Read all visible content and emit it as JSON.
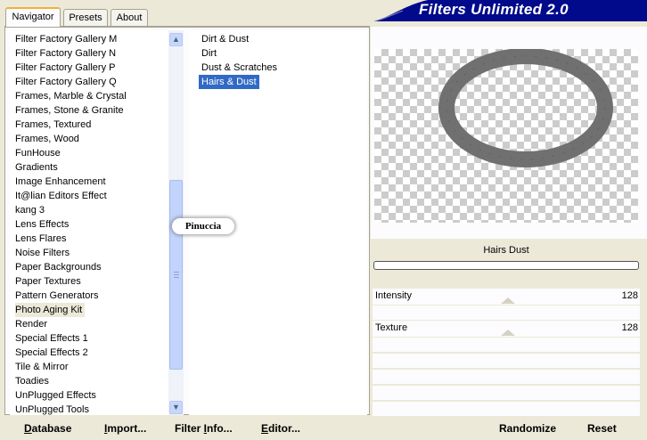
{
  "window": {
    "banner_title": "Filters Unlimited 2.0"
  },
  "tabs": [
    {
      "label": "Navigator",
      "active": true
    },
    {
      "label": "Presets",
      "active": false
    },
    {
      "label": "About",
      "active": false
    }
  ],
  "categories": {
    "items": [
      "Filter Factory Gallery M",
      "Filter Factory Gallery N",
      "Filter Factory Gallery P",
      "Filter Factory Gallery Q",
      "Frames, Marble & Crystal",
      "Frames, Stone & Granite",
      "Frames, Textured",
      "Frames, Wood",
      "FunHouse",
      "Gradients",
      "Image Enhancement",
      "It@lian Editors Effect",
      "kang 3",
      "Lens Effects",
      "Lens Flares",
      "Noise Filters",
      "Paper Backgrounds",
      "Paper Textures",
      "Pattern Generators",
      "Photo Aging Kit",
      "Render",
      "Special Effects 1",
      "Special Effects 2",
      "Tile & Mirror",
      "Toadies",
      "UnPlugged Effects",
      "UnPlugged Tools"
    ],
    "selected": "Photo Aging Kit"
  },
  "filters": {
    "items": [
      "Dirt & Dust",
      "Dirt",
      "Dust & Scratches",
      "Hairs & Dust"
    ],
    "selected": "Hairs & Dust"
  },
  "watermark": "Pinuccia",
  "preview": {
    "filter_name": "Hairs  Dust"
  },
  "controls": [
    {
      "label": "Intensity",
      "value": "128"
    },
    {
      "label": "Texture",
      "value": "128"
    }
  ],
  "buttons": {
    "database": {
      "underline": "D",
      "rest": "atabase"
    },
    "import": {
      "underline": "I",
      "rest": "mport..."
    },
    "filter_info": {
      "start": "Filter ",
      "underline": "I",
      "rest": "nfo..."
    },
    "editor": {
      "underline": "E",
      "rest": "ditor..."
    },
    "randomize": "Randomize",
    "reset": "Reset"
  },
  "colors": {
    "banner": "#000a8a",
    "selection": "#316ac5",
    "tab_accent": "#f0b03a"
  }
}
